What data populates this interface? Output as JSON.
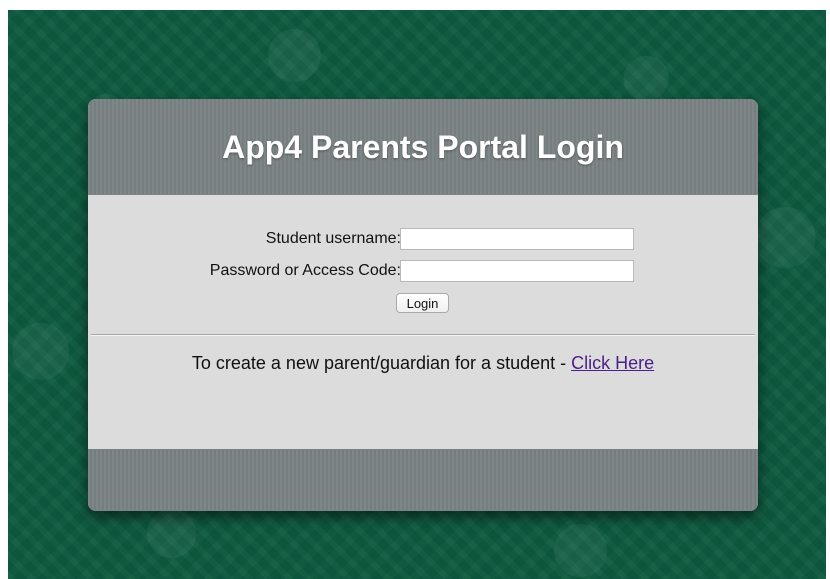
{
  "page": {
    "background_color": "#0d5a3f",
    "panel_color": "#dcdcdc",
    "header_color": "#7b8283",
    "link_color": "#4b1e8a"
  },
  "header": {
    "title": "App4 Parents Portal Login"
  },
  "form": {
    "username_label": "Student username:",
    "username_value": "",
    "password_label": "Password or Access Code:",
    "password_value": "",
    "login_button": "Login"
  },
  "footer_note": {
    "text": "To create a new parent/guardian for a student - ",
    "link_text": "Click Here"
  }
}
